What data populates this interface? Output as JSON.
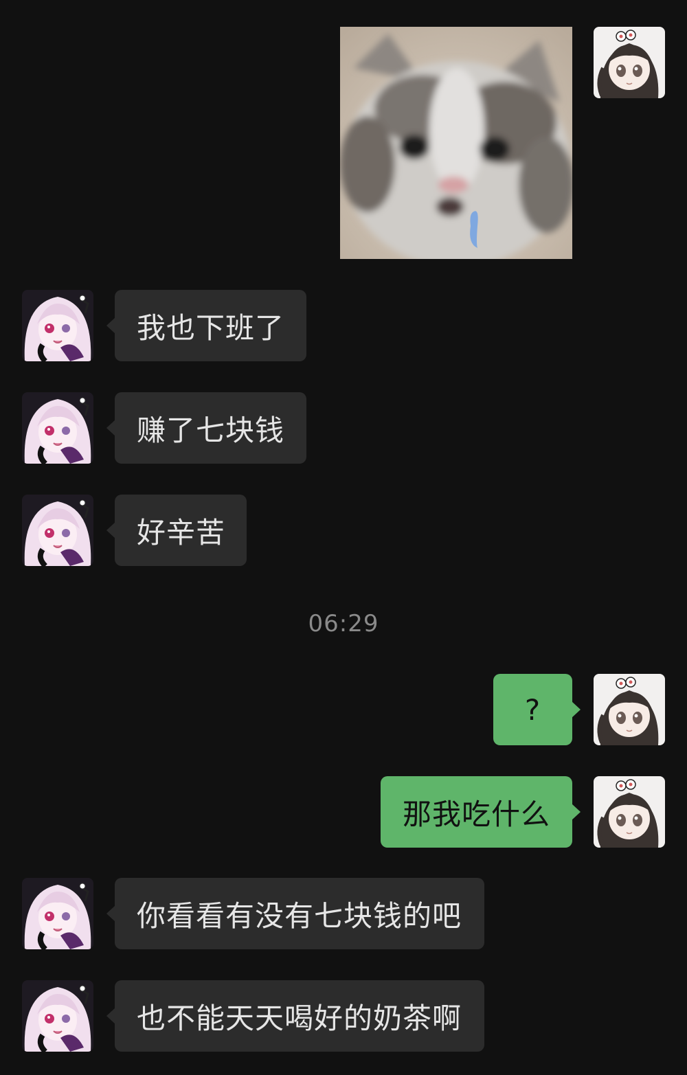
{
  "chat": {
    "timestamp": "06:29",
    "messages": [
      {
        "side": "out",
        "kind": "sticker",
        "sticker": "crying-kitten-sticker"
      },
      {
        "side": "in",
        "kind": "text",
        "text": "我也下班了"
      },
      {
        "side": "in",
        "kind": "text",
        "text": "赚了七块钱"
      },
      {
        "side": "in",
        "kind": "text",
        "text": "好辛苦"
      },
      {
        "side": "out",
        "kind": "text",
        "text": "?"
      },
      {
        "side": "out",
        "kind": "text",
        "text": "那我吃什么"
      },
      {
        "side": "in",
        "kind": "text",
        "text": "你看看有没有七块钱的吧"
      },
      {
        "side": "in",
        "kind": "text",
        "text": "也不能天天喝好的奶茶啊"
      }
    ]
  },
  "colors": {
    "background": "#111111",
    "incoming_bubble": "#2c2c2c",
    "outgoing_bubble": "#5fb56a",
    "incoming_text": "#e6e6e6",
    "outgoing_text": "#111111",
    "timestamp_text": "#8a8a8a"
  },
  "icons": {
    "self_avatar": "anime-girl-dark-hair-avatar",
    "contact_avatar": "anime-girl-pink-hair-avatar"
  }
}
